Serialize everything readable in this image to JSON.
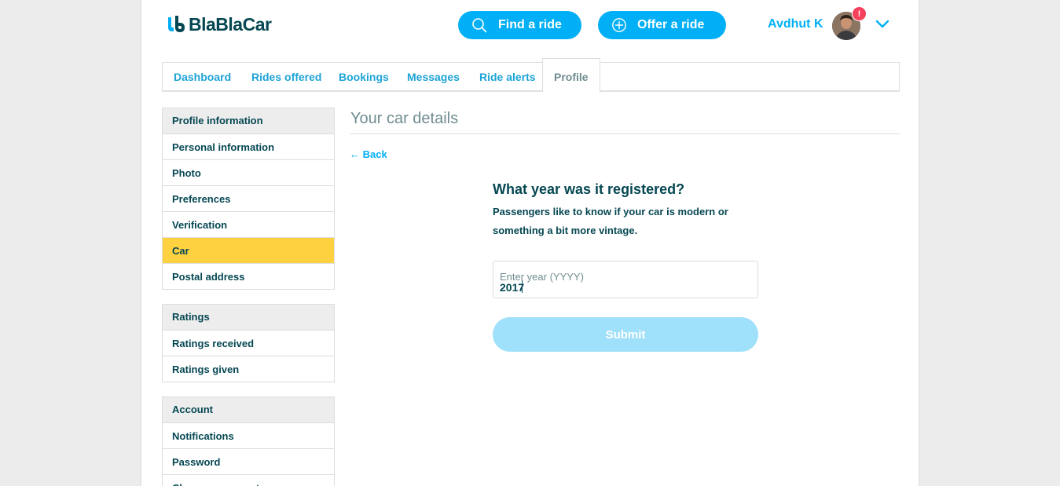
{
  "brand": {
    "name": "BlaBlaCar",
    "accent": "#00aff5",
    "dark": "#054752",
    "highlight": "#fdd13f"
  },
  "header": {
    "find_ride_label": "Find a ride",
    "offer_ride_label": "Offer a ride",
    "user_name": "Avdhut K",
    "notification_badge": "!"
  },
  "tabs": [
    {
      "label": "Dashboard",
      "active": false
    },
    {
      "label": "Rides offered",
      "active": false
    },
    {
      "label": "Bookings",
      "active": false
    },
    {
      "label": "Messages",
      "active": false
    },
    {
      "label": "Ride alerts",
      "active": false
    },
    {
      "label": "Profile",
      "active": true
    }
  ],
  "sidebar": {
    "profile": {
      "heading": "Profile information",
      "items": [
        "Personal information",
        "Photo",
        "Preferences",
        "Verification",
        "Car",
        "Postal address"
      ],
      "selected": "Car"
    },
    "ratings": {
      "heading": "Ratings",
      "items": [
        "Ratings received",
        "Ratings given"
      ]
    },
    "account": {
      "heading": "Account",
      "items": [
        "Notifications",
        "Password",
        "Close my account"
      ]
    }
  },
  "main": {
    "title": "Your car details",
    "back_label": "← Back",
    "question": "What year was it registered?",
    "description": "Passengers like to know if your car is modern or something a bit more vintage.",
    "year_input": {
      "placeholder": "Enter year (YYYY)",
      "value": "2017"
    },
    "submit_label": "Submit"
  }
}
